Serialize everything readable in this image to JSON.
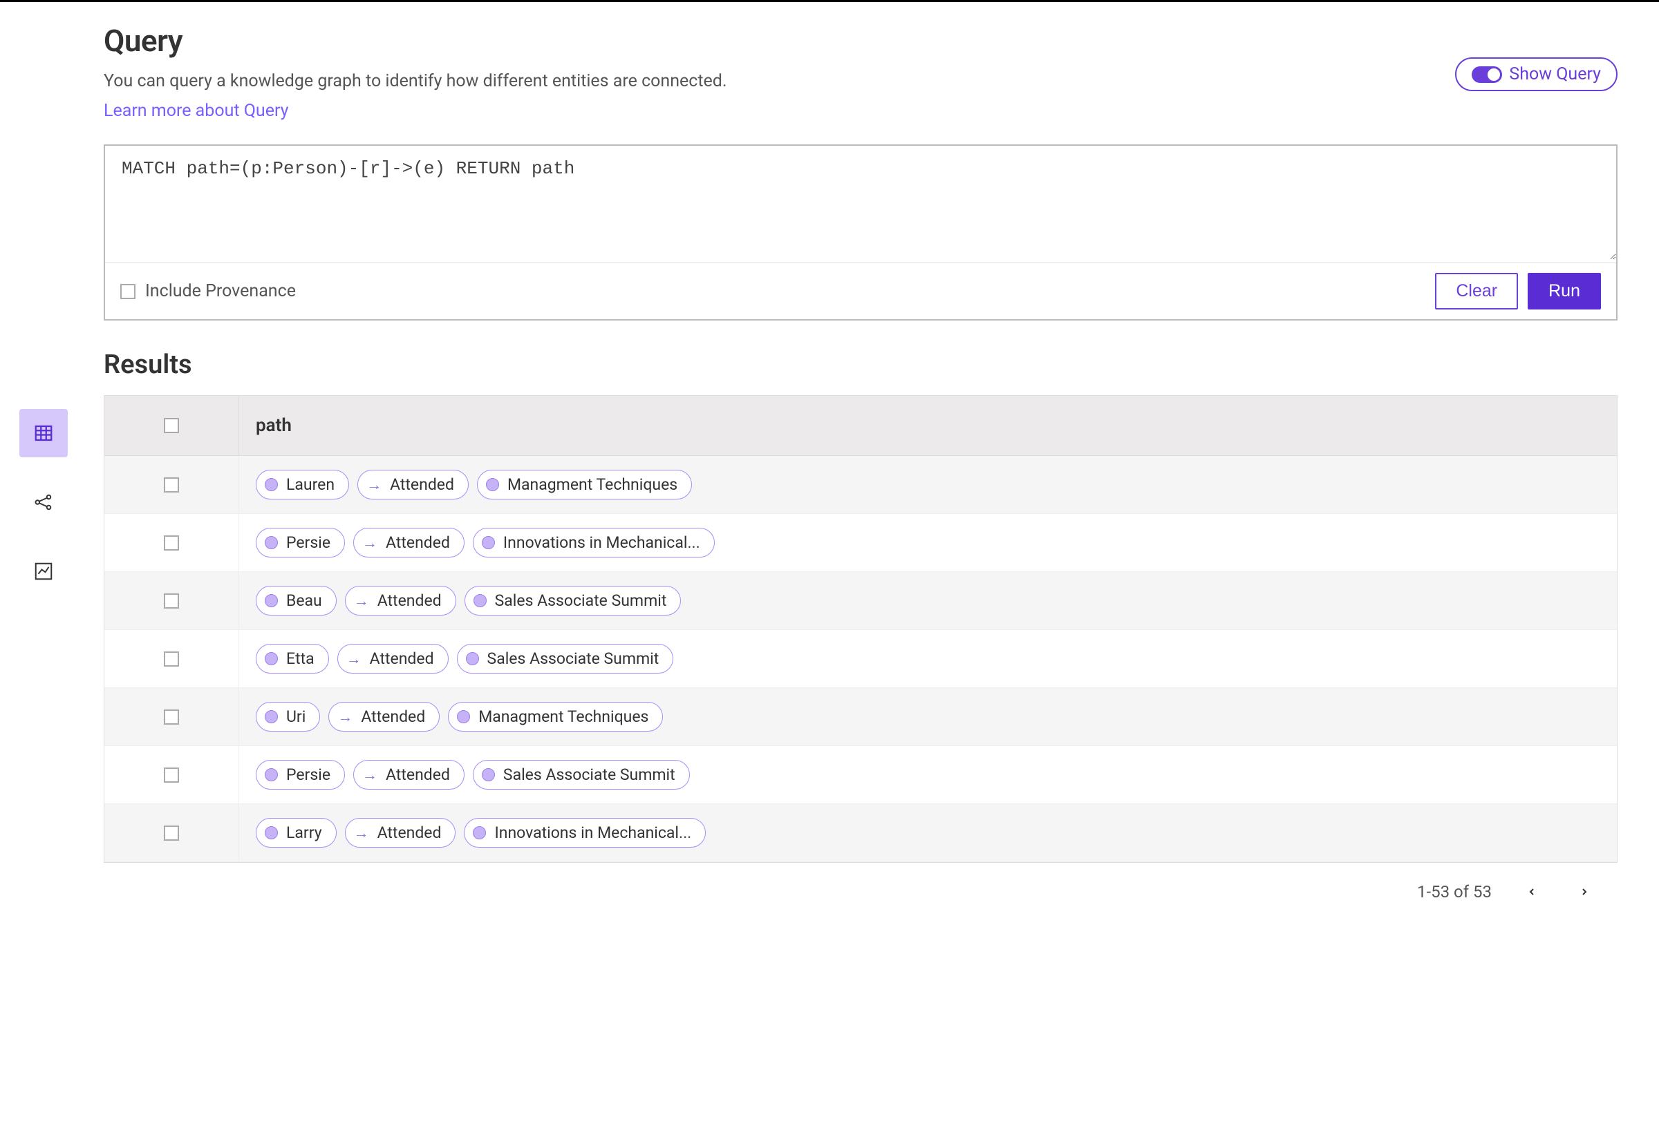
{
  "header": {
    "title": "Query",
    "subtitle": "You can query a knowledge graph to identify how different entities are connected.",
    "learn_more": "Learn more about Query",
    "show_query_label": "Show Query"
  },
  "query": {
    "text": "MATCH path=(p:Person)-[r]->(e) RETURN path",
    "include_provenance_label": "Include Provenance",
    "clear_label": "Clear",
    "run_label": "Run"
  },
  "results": {
    "title": "Results",
    "column_header": "path",
    "rows": [
      {
        "person": "Lauren",
        "relation": "Attended",
        "target": "Managment Techniques"
      },
      {
        "person": "Persie",
        "relation": "Attended",
        "target": "Innovations in Mechanical..."
      },
      {
        "person": "Beau",
        "relation": "Attended",
        "target": "Sales Associate Summit"
      },
      {
        "person": "Etta",
        "relation": "Attended",
        "target": "Sales Associate Summit"
      },
      {
        "person": "Uri",
        "relation": "Attended",
        "target": "Managment Techniques"
      },
      {
        "person": "Persie",
        "relation": "Attended",
        "target": "Sales Associate Summit"
      },
      {
        "person": "Larry",
        "relation": "Attended",
        "target": "Innovations in Mechanical..."
      }
    ],
    "pagination_label": "1-53 of 53"
  }
}
